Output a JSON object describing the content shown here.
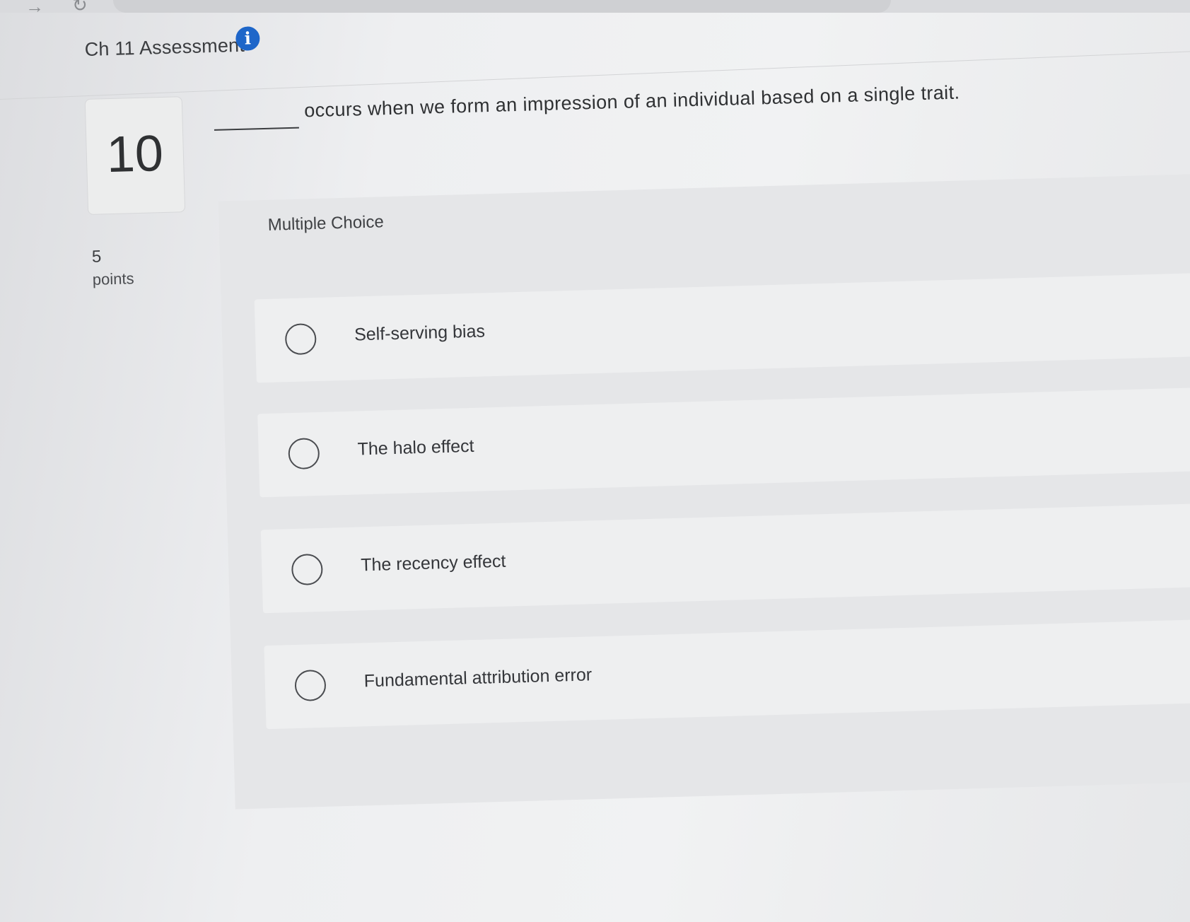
{
  "browser": {
    "forward_icon": "arrow-right-icon",
    "reload_icon": "reload-icon"
  },
  "header": {
    "title": "Ch 11 Assessment",
    "info_icon": "info-icon"
  },
  "question": {
    "number": "10",
    "points_value": "5",
    "points_label": "points",
    "text": "occurs when we form an impression of an individual based on a single trait."
  },
  "answer_section": {
    "type_label": "Multiple Choice",
    "options": [
      {
        "label": "Self-serving bias"
      },
      {
        "label": "The halo effect"
      },
      {
        "label": "The recency effect"
      },
      {
        "label": "Fundamental attribution error"
      }
    ]
  },
  "colors": {
    "accent": "#1e66c9",
    "background": "#e9eaec",
    "text": "#2f3133"
  }
}
